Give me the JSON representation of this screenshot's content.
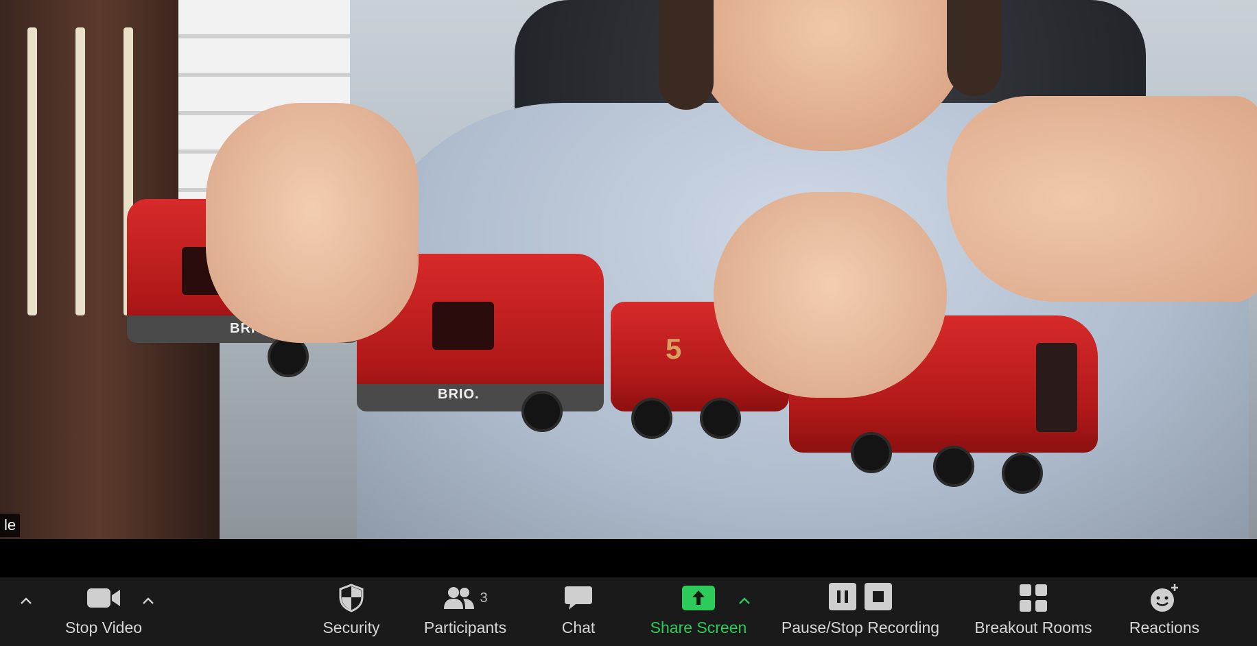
{
  "video": {
    "participant_name_fragment": "le",
    "brio_label_1": "BRIO",
    "brio_label_2": "BRIO.",
    "engine_number": "5"
  },
  "toolbar": {
    "stop_video_label": "Stop Video",
    "security_label": "Security",
    "participants_label": "Participants",
    "participants_count": "3",
    "chat_label": "Chat",
    "share_screen_label": "Share Screen",
    "recording_label": "Pause/Stop Recording",
    "breakout_rooms_label": "Breakout Rooms",
    "reactions_label": "Reactions"
  },
  "colors": {
    "toolbar_bg": "#1a1a1a",
    "label": "#d6d6d6",
    "share_green": "#2ccb5a"
  },
  "icons": {
    "audio_caret": "chevron-up-icon",
    "video": "video-camera-icon",
    "security": "shield-icon",
    "participants": "people-icon",
    "chat": "chat-bubble-icon",
    "share": "share-arrow-up-icon",
    "pause": "pause-icon",
    "stop": "stop-icon",
    "breakout": "grid-icon",
    "reactions": "smiley-plus-icon"
  }
}
